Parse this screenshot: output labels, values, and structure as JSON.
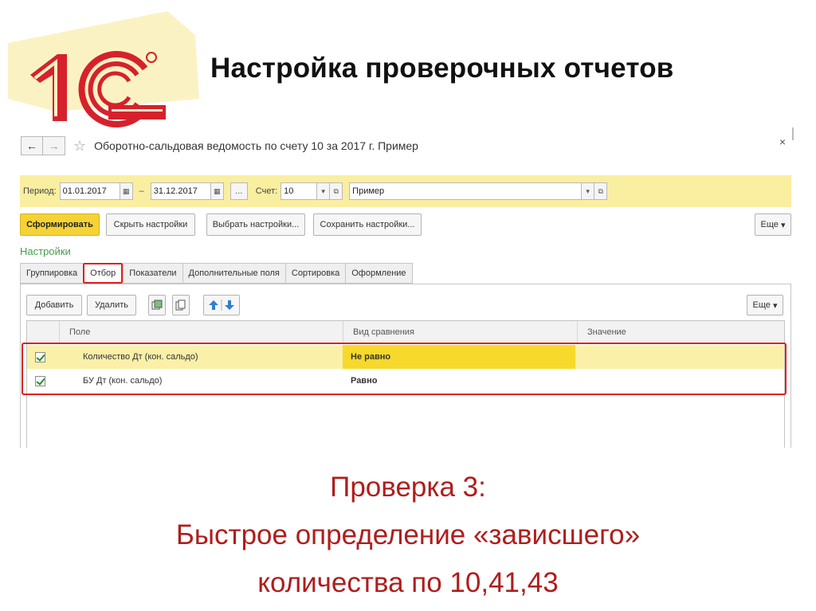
{
  "slide": {
    "title": "Настройка проверочных отчетов",
    "caption_lines": [
      "Проверка 3:",
      "Быстрое определение «зависшего»",
      "количества по 10,41,43"
    ],
    "logo_text": "1С"
  },
  "window": {
    "back_label": "←",
    "forward_label": "→",
    "title": "Оборотно-сальдовая ведомость по счету 10 за 2017 г. Пример",
    "close_label": "×"
  },
  "period_bar": {
    "period_label": "Период:",
    "date_from": "01.01.2017",
    "dash": "–",
    "date_to": "31.12.2017",
    "dots_label": "...",
    "account_label": "Счет:",
    "account_value": "10",
    "org_value": "Пример"
  },
  "toolbar": {
    "generate": "Сформировать",
    "hide_settings": "Скрыть настройки",
    "choose_settings": "Выбрать настройки...",
    "save_settings": "Сохранить настройки...",
    "more": "Еще"
  },
  "settings_label": "Настройки",
  "tabs": [
    {
      "label": "Группировка"
    },
    {
      "label": "Отбор",
      "active": true
    },
    {
      "label": "Показатели"
    },
    {
      "label": "Дополнительные поля"
    },
    {
      "label": "Сортировка"
    },
    {
      "label": "Оформление"
    }
  ],
  "filter_toolbar": {
    "add": "Добавить",
    "delete": "Удалить",
    "more": "Еще"
  },
  "grid": {
    "columns": [
      "Поле",
      "Вид сравнения",
      "Значение"
    ],
    "rows": [
      {
        "checked": true,
        "field": "Количество Дт (кон. сальдо)",
        "comparison": "Не равно",
        "value": ""
      },
      {
        "checked": true,
        "field": "БУ Дт (кон. сальдо)",
        "comparison": "Равно",
        "value": ""
      }
    ]
  },
  "colors": {
    "accent_yellow": "#f5d336",
    "highlight_red": "#e02020",
    "caption_red": "#b01d1d"
  }
}
